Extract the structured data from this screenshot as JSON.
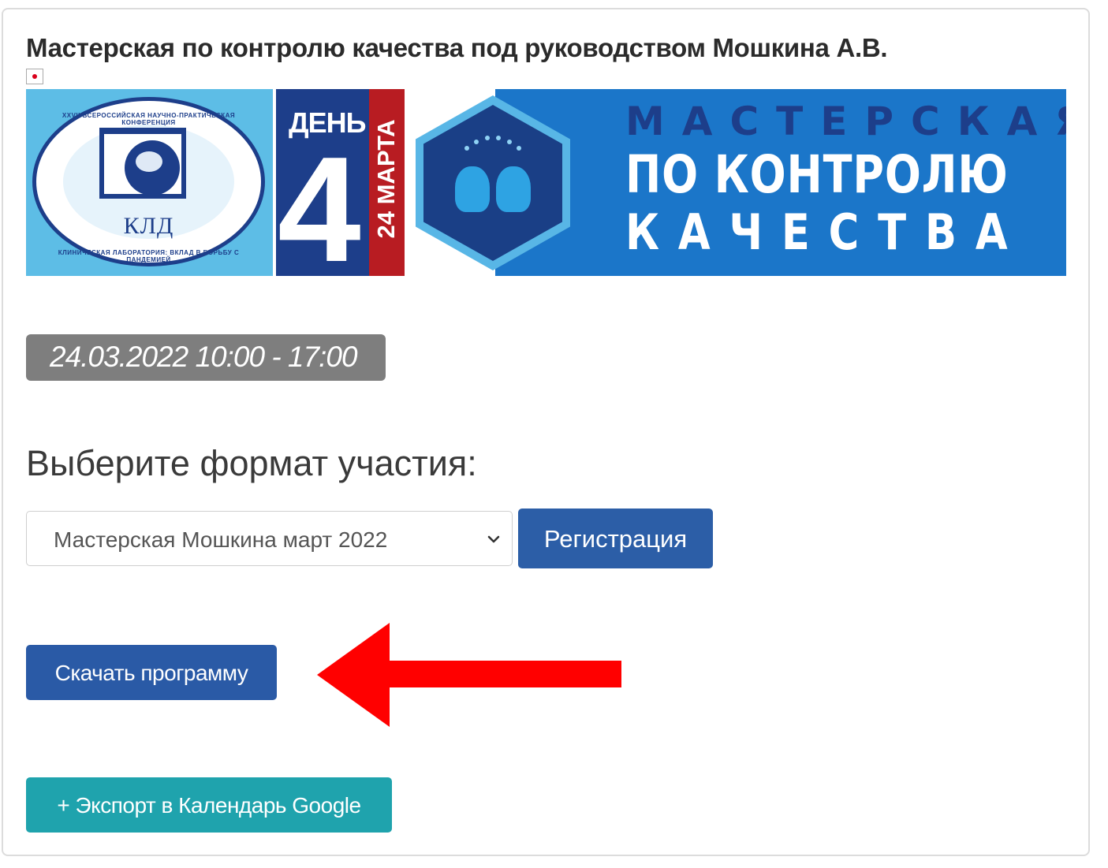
{
  "event": {
    "title": "Мастерская по контролю качества под руководством Мошкина А.В.",
    "banner": {
      "logo_text": "КЛД",
      "logo_ring_top": "XXVII ВСЕРОССИЙСКАЯ НАУЧНО-ПРАКТИЧЕСКАЯ КОНФЕРЕНЦИЯ",
      "logo_ring_bottom": "КЛИНИЧЕСКАЯ ЛАБОРАТОРИЯ: ВКЛАД В БОРЬБУ С ПАНДЕМИЕЙ",
      "day_label": "ДЕНЬ",
      "day_number": "4",
      "date": "24 МАРТА",
      "line1": "МАСТЕРСКАЯ",
      "line2": "ПО КОНТРОЛЮ",
      "line3": "КАЧЕСТВА"
    },
    "datetime": "24.03.2022 10:00 - 17:00",
    "format_heading": "Выберите формат участия:",
    "format_select_value": "Мастерская Мошкина март 2022",
    "register_label": "Регистрация",
    "download_label": "Скачать программу",
    "google_export_label": "+ Экспорт в Календарь Google"
  },
  "colors": {
    "register_button": "#2c5ea7",
    "download_button": "#2a5aa6",
    "google_button": "#1fa3ad",
    "date_badge": "#7e7e7e",
    "annotation_arrow": "#ff0000"
  },
  "icons": {
    "select_chevron": "chevron-down-icon",
    "annotation_arrow": "arrow-left-icon",
    "broken_image": "broken-image-icon"
  }
}
